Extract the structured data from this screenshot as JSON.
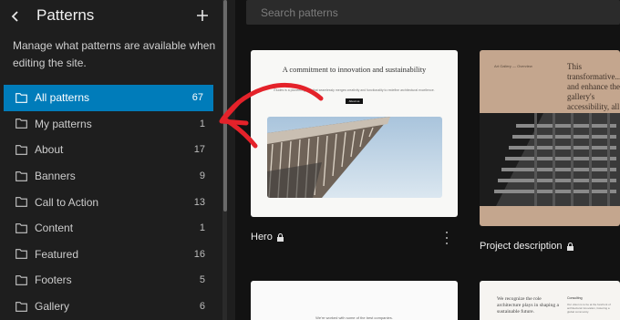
{
  "sidebar": {
    "title": "Patterns",
    "description": "Manage what patterns are available when editing the site.",
    "categories": [
      {
        "label": "All patterns",
        "count": "67"
      },
      {
        "label": "My patterns",
        "count": "1"
      },
      {
        "label": "About",
        "count": "17"
      },
      {
        "label": "Banners",
        "count": "9"
      },
      {
        "label": "Call to Action",
        "count": "13"
      },
      {
        "label": "Content",
        "count": "1"
      },
      {
        "label": "Featured",
        "count": "16"
      },
      {
        "label": "Footers",
        "count": "5"
      },
      {
        "label": "Gallery",
        "count": "6"
      }
    ],
    "icons": {
      "back": "chevron-left-icon",
      "add": "plus-icon",
      "category": "folder-icon"
    }
  },
  "main": {
    "search_placeholder": "Search patterns",
    "cards": {
      "hero": {
        "label": "Hero",
        "preview_heading": "A commitment to innovation and sustainability",
        "preview_sub": "Études is a pioneering firm that seamlessly merges creativity and functionality to redefine architectural excellence.",
        "preview_button": "About us"
      },
      "project": {
        "label": "Project description",
        "preview_small": "Art Gallery — Overview",
        "preview_text": "This transformative... and enhance the gallery's accessibility, all while preserving its heritage."
      },
      "bottom_left": {
        "preview_text": "We're worked with some of the best companies."
      },
      "bottom_right": {
        "preview_text": "We recognize the role architecture plays in shaping a sustainable future.",
        "preview_label": "Consulting",
        "preview_desc": "Our vision is to be at the forefront of architectural innovation, fostering a global community."
      }
    }
  },
  "colors": {
    "accent": "#007cba",
    "annotation_arrow": "#e4222a"
  }
}
